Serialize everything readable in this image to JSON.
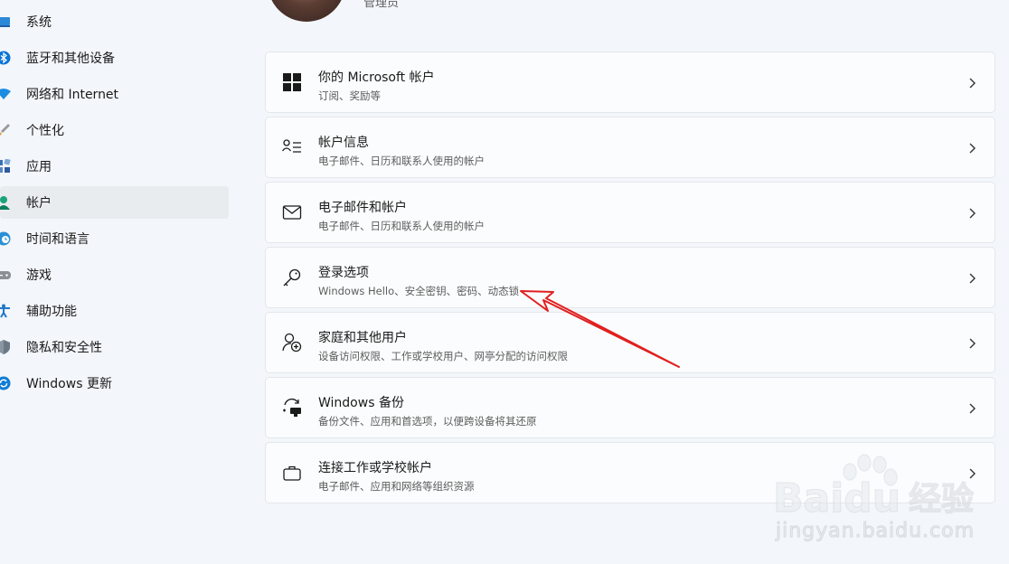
{
  "sidebar": {
    "items": [
      {
        "label": "系统",
        "icon": "system-icon"
      },
      {
        "label": "蓝牙和其他设备",
        "icon": "bluetooth-icon"
      },
      {
        "label": "网络和 Internet",
        "icon": "wifi-icon"
      },
      {
        "label": "个性化",
        "icon": "brush-icon"
      },
      {
        "label": "应用",
        "icon": "apps-icon"
      },
      {
        "label": "帐户",
        "icon": "account-icon",
        "active": true
      },
      {
        "label": "时间和语言",
        "icon": "globe-clock-icon"
      },
      {
        "label": "游戏",
        "icon": "gamepad-icon"
      },
      {
        "label": "辅助功能",
        "icon": "accessibility-icon"
      },
      {
        "label": "隐私和安全性",
        "icon": "shield-icon"
      },
      {
        "label": "Windows 更新",
        "icon": "update-icon"
      }
    ]
  },
  "profile": {
    "role": "管理员"
  },
  "cards": [
    {
      "title": "你的 Microsoft 帐户",
      "subtitle": "订阅、奖励等",
      "icon": "windows-logo-icon"
    },
    {
      "title": "帐户信息",
      "subtitle": "电子邮件、日历和联系人使用的帐户",
      "icon": "person-list-icon"
    },
    {
      "title": "电子邮件和帐户",
      "subtitle": "电子邮件、日历和联系人使用的帐户",
      "icon": "mail-icon"
    },
    {
      "title": "登录选项",
      "subtitle": "Windows Hello、安全密钥、密码、动态锁",
      "icon": "key-icon"
    },
    {
      "title": "家庭和其他用户",
      "subtitle": "设备访问权限、工作或学校用户、网亭分配的访问权限",
      "icon": "person-add-icon"
    },
    {
      "title": "Windows 备份",
      "subtitle": "备份文件、应用和首选项，以便跨设备将其还原",
      "icon": "backup-icon"
    },
    {
      "title": "连接工作或学校帐户",
      "subtitle": "电子邮件、应用和网络等组织资源",
      "icon": "briefcase-icon"
    }
  ],
  "watermark": {
    "brand": "Baidu",
    "brand_cn": "经验",
    "url": "jingyan.baidu.com"
  },
  "colors": {
    "accent": "#0067c0",
    "annotation_arrow": "#e02020"
  }
}
